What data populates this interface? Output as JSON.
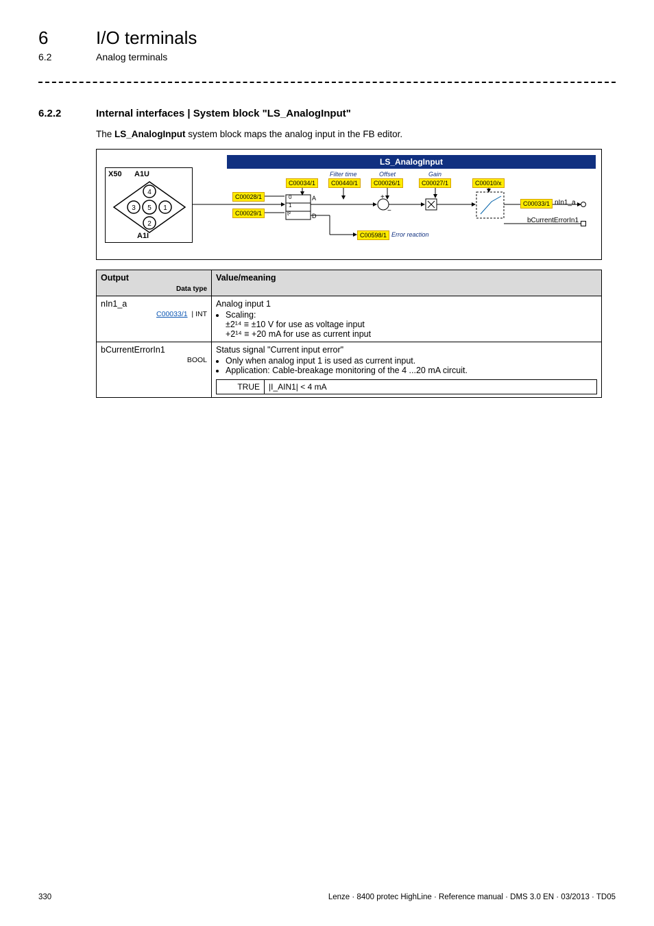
{
  "header": {
    "chapter_num": "6",
    "chapter_title": "I/O terminals",
    "section_num": "6.2",
    "section_title": "Analog terminals"
  },
  "section": {
    "num": "6.2.2",
    "title": "Internal interfaces | System block \"LS_AnalogInput\"",
    "intro_prefix": "The ",
    "intro_bold": "LS_AnalogInput",
    "intro_suffix": " system block maps the analog input in the FB editor."
  },
  "diagram": {
    "fb_title": "LS_AnalogInput",
    "connector": {
      "x50": "X50",
      "a1u": "A1U",
      "a1i": "A1I"
    },
    "labels": {
      "filter_time": "Filter time",
      "offset": "Offset",
      "gain": "Gain",
      "error_reaction": "Error reaction",
      "switch_A": "A",
      "switch_D": "D",
      "switch_0": "0",
      "switch_1": "1",
      "switch_t2": "t²"
    },
    "codes": {
      "c00034": "C00034/1",
      "c00440": "C00440/1",
      "c00026": "C00026/1",
      "c00027": "C00027/1",
      "c00010": "C00010/x",
      "c00028": "C00028/1",
      "c00029": "C00029/1",
      "c00598": "C00598/1",
      "c00033": "C00033/1"
    },
    "outputs": {
      "nIn1_a": "nIn1_a",
      "bCurrentErrorIn1": "bCurrentErrorIn1"
    }
  },
  "table": {
    "head_output": "Output",
    "head_data_type": "Data type",
    "head_value": "Value/meaning",
    "rows": [
      {
        "name": "nIn1_a",
        "code": "C00033/1",
        "dtype": "INT",
        "title": "Analog input 1",
        "bullet1": "Scaling:",
        "line1": "±2¹⁴ ≡ ±10 V for use as voltage input",
        "line2": "+2¹⁴ ≡ +20 mA for use as current input"
      },
      {
        "name": "bCurrentErrorIn1",
        "dtype": "BOOL",
        "title": "Status signal \"Current input error\"",
        "bullet1": "Only when analog input 1 is used as current input.",
        "bullet2": "Application: Cable-breakage monitoring of the 4 ...20 mA circuit.",
        "true_label": "TRUE",
        "true_value": "|I_AIN1| < 4 mA"
      }
    ]
  },
  "footer": {
    "page": "330",
    "doc": "Lenze · 8400 protec HighLine · Reference manual · DMS 3.0 EN · 03/2013 · TD05"
  }
}
